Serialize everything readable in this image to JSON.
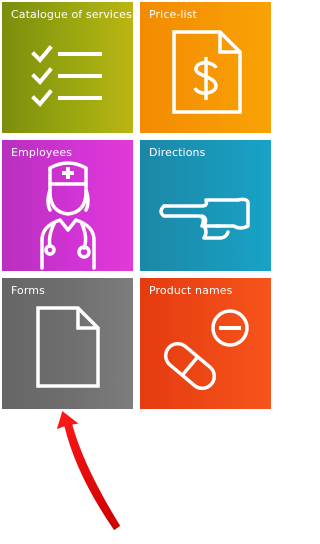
{
  "tiles": [
    {
      "id": "catalogue",
      "label": "Catalogue of services",
      "icon": "checklist-icon",
      "color": "#9aa810"
    },
    {
      "id": "price-list",
      "label": "Price-list",
      "icon": "dollar-document-icon",
      "color": "#f79605"
    },
    {
      "id": "employees",
      "label": "Employees",
      "icon": "nurse-icon",
      "color": "#d334d6"
    },
    {
      "id": "directions",
      "label": "Directions",
      "icon": "pointing-hand-icon",
      "color": "#1a9bbd"
    },
    {
      "id": "forms",
      "label": "Forms",
      "icon": "blank-document-icon",
      "color": "#6e6e6e"
    },
    {
      "id": "product-names",
      "label": "Product names",
      "icon": "pills-icon",
      "color": "#f0481a"
    }
  ],
  "annotation": {
    "icon": "red-curved-arrow-icon",
    "color": "#e60000",
    "points_to": "forms"
  }
}
